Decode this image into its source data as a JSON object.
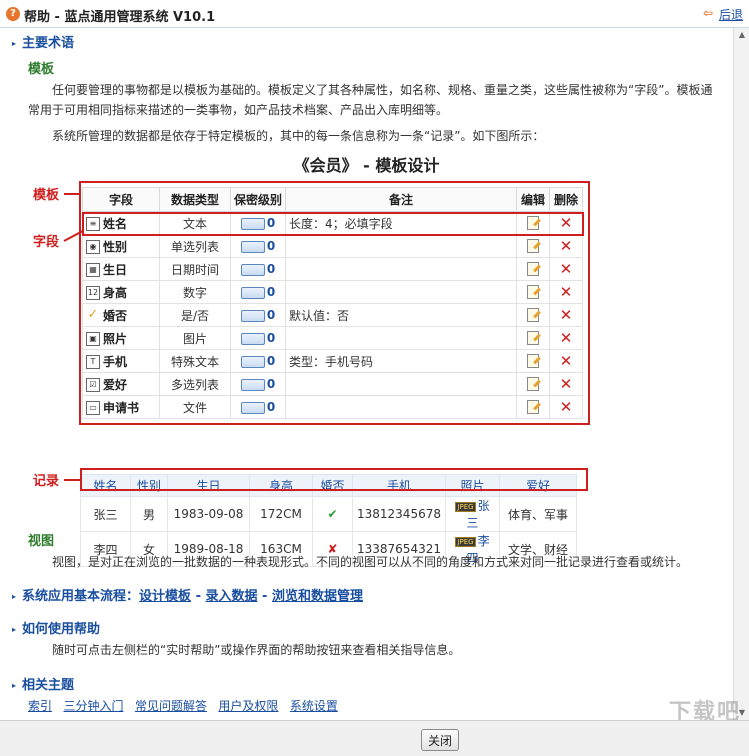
{
  "window": {
    "title": "帮助 - 蓝点通用管理系统 V10.1",
    "back_label": "后退"
  },
  "section_terms": {
    "heading": "主要术语",
    "template": {
      "heading": "模板",
      "para1": "任何要管理的事物都是以模板为基础的。模板定义了其各种属性，如名称、规格、重量之类，这些属性被称为“字段”。模板通常用于可用相同指标来描述的一类事物，如产品技术档案、产品出入库明细等。",
      "para2": "系统所管理的数据都是依存于特定模板的，其中的每一条信息称为一条“记录”。如下图所示："
    },
    "figure": {
      "title": "《会员》 - 模板设计",
      "label_template": "模板",
      "label_field": "字段",
      "label_record": "记录",
      "template_table": {
        "headers": [
          "字段",
          "数据类型",
          "保密级别",
          "备注",
          "编辑",
          "删除"
        ],
        "rows": [
          {
            "icon": "text-doc-icon",
            "name": "姓名",
            "type": "文本",
            "level": "0",
            "note": "长度：4；必填字段"
          },
          {
            "icon": "radio-list-icon",
            "name": "性别",
            "type": "单选列表",
            "level": "0",
            "note": ""
          },
          {
            "icon": "calendar-icon",
            "name": "生日",
            "type": "日期时间",
            "level": "0",
            "note": ""
          },
          {
            "icon": "number-icon",
            "name": "身高",
            "type": "数字",
            "level": "0",
            "note": ""
          },
          {
            "icon": "checkmark-icon",
            "name": "婚否",
            "type": "是/否",
            "level": "0",
            "note": "默认值：否"
          },
          {
            "icon": "image-icon",
            "name": "照片",
            "type": "图片",
            "level": "0",
            "note": ""
          },
          {
            "icon": "special-text-icon",
            "name": "手机",
            "type": "特殊文本",
            "level": "0",
            "note": "类型：手机号码"
          },
          {
            "icon": "checkbox-list-icon",
            "name": "爱好",
            "type": "多选列表",
            "level": "0",
            "note": ""
          },
          {
            "icon": "folder-icon",
            "name": "申请书",
            "type": "文件",
            "level": "0",
            "note": ""
          }
        ]
      },
      "records_table": {
        "headers": [
          "姓名",
          "性别",
          "生日",
          "身高",
          "婚否",
          "手机",
          "照片",
          "爱好"
        ],
        "rows": [
          {
            "name": "张三",
            "gender": "男",
            "birthday": "1983-09-08",
            "height": "172CM",
            "married": "check",
            "phone": "13812345678",
            "photo": "张三",
            "hobby": "体育、军事"
          },
          {
            "name": "李四",
            "gender": "女",
            "birthday": "1989-08-18",
            "height": "163CM",
            "married": "cross",
            "phone": "13387654321",
            "photo": "李四",
            "hobby": "文学、财经"
          }
        ],
        "photo_tag": "JPEG"
      }
    },
    "view": {
      "heading": "视图",
      "para": "视图，是对正在浏览的一批数据的一种表现形式。不同的视图可以从不同的角度和方式来对同一批记录进行查看或统计。"
    }
  },
  "section_flow": {
    "heading": "系统应用基本流程：",
    "link1": "设计模板",
    "sep1": " - ",
    "link2": "录入数据",
    "sep2": " - ",
    "link3": "浏览和数据管理"
  },
  "section_howto": {
    "heading": "如何使用帮助",
    "para": "随时可点击左侧栏的“实时帮助”或操作界面的帮助按钮来查看相关指导信息。"
  },
  "section_related": {
    "heading": "相关主题",
    "links": [
      "索引",
      "三分钟入门",
      "常见问题解答",
      "用户及权限",
      "系统设置"
    ]
  },
  "footer": {
    "close_label": "关闭"
  },
  "watermark": {
    "text": "下载吧",
    "sub": "www.xiazaiba.com"
  },
  "colors": {
    "heading_blue": "#1a4fa0",
    "subheading_green": "#2e7d2e",
    "highlight_red": "#d01e1e"
  }
}
